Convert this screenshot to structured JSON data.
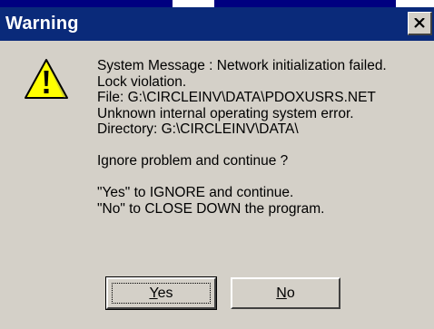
{
  "window": {
    "title": "Warning"
  },
  "icons": {
    "warning": "warning-triangle-icon",
    "close": "close-icon"
  },
  "colors": {
    "titlebar": "#0a2a7a",
    "face": "#d4d0c8",
    "icon_fill": "#ffff00"
  },
  "message": {
    "lines": [
      "System Message : Network initialization failed.",
      "Lock violation.",
      "File: G:\\CIRCLEINV\\DATA\\PDOXUSRS.NET",
      "Unknown internal operating system error.",
      "Directory: G:\\CIRCLEINV\\DATA\\"
    ],
    "question": "Ignore problem and continue ?",
    "instructions": [
      "\"Yes\" to IGNORE and continue.",
      "\"No\" to CLOSE DOWN the program."
    ]
  },
  "buttons": {
    "yes": {
      "mnemonic": "Y",
      "rest": "es"
    },
    "no": {
      "mnemonic": "N",
      "rest": "o"
    }
  }
}
